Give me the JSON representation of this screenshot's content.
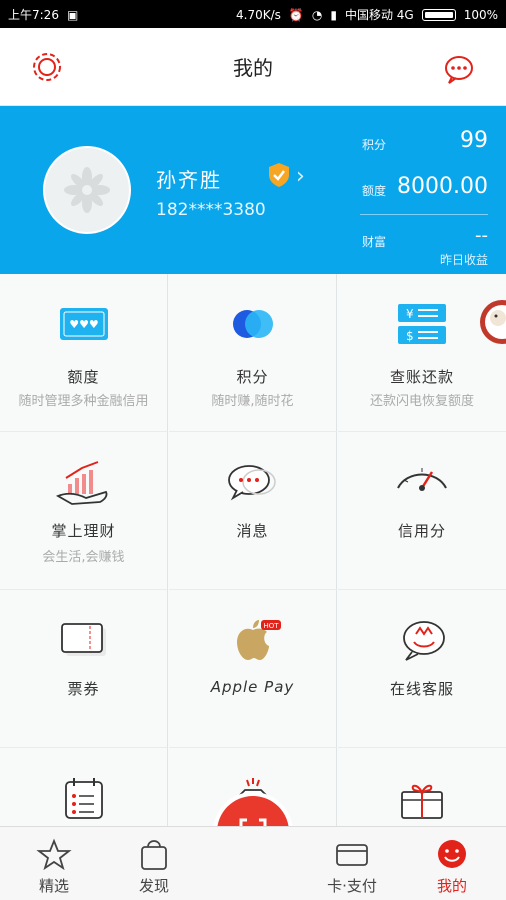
{
  "status": {
    "time": "上午7:26",
    "speed": "4.70K/s",
    "carrier": "中国移动 4G",
    "battery": "100%"
  },
  "header": {
    "title": "我的"
  },
  "profile": {
    "name": "孙齐胜",
    "phone": "182****3380",
    "points_label": "积分",
    "points_value": "99",
    "credit_label": "额度",
    "credit_value": "8000.00",
    "wealth_label": "财富",
    "wealth_value": "--",
    "yesterday_label": "昨日收益"
  },
  "grid": [
    {
      "label": "额度",
      "sub": "随时管理多种金融信用",
      "icon": "card-icon"
    },
    {
      "label": "积分",
      "sub": "随时赚,随时花",
      "icon": "points-circles-icon"
    },
    {
      "label": "查账还款",
      "sub": "还款闪电恢复额度",
      "icon": "bill-icon"
    },
    {
      "label": "掌上理财",
      "sub": "会生活,会赚钱",
      "icon": "chart-hand-icon"
    },
    {
      "label": "消息",
      "sub": "",
      "icon": "message-icon"
    },
    {
      "label": "信用分",
      "sub": "",
      "icon": "gauge-icon"
    },
    {
      "label": "票券",
      "sub": "",
      "icon": "ticket-icon"
    },
    {
      "label": "Apple Pay",
      "sub": "",
      "icon": "apple-icon",
      "badge": "HOT"
    },
    {
      "label": "在线客服",
      "sub": "",
      "icon": "service-icon"
    },
    {
      "label": "",
      "sub": "",
      "icon": "calendar-list-icon"
    },
    {
      "label": "",
      "sub": "",
      "icon": "diamond-icon"
    },
    {
      "label": "",
      "sub": "",
      "icon": "gift-icon"
    }
  ],
  "tabs": [
    {
      "label": "精选",
      "icon": "star-icon"
    },
    {
      "label": "发现",
      "icon": "bag-icon"
    },
    {
      "label": "卡·支付",
      "icon": "card-icon"
    },
    {
      "label": "我的",
      "icon": "smile-icon"
    }
  ],
  "colors": {
    "brand_blue": "#0aa6ec",
    "accent_red": "#e2231a"
  }
}
